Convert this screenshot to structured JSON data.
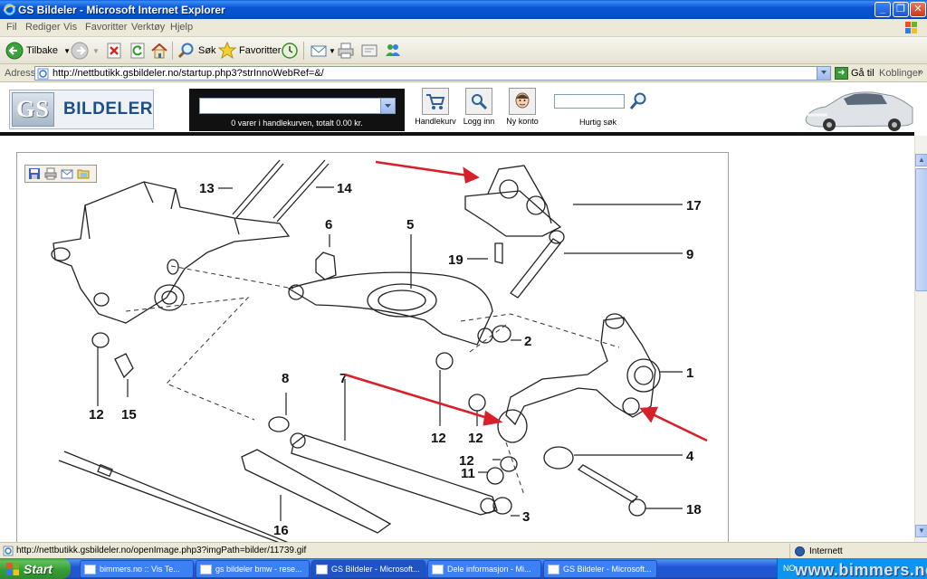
{
  "window": {
    "title": "GS Bildeler - Microsoft Internet Explorer",
    "minimize_glyph": "_",
    "maximize_glyph": "❐",
    "close_glyph": "✕"
  },
  "menu": [
    "Fil",
    "Rediger",
    "Vis",
    "Favoritter",
    "Verktøy",
    "Hjelp"
  ],
  "toolbar": {
    "back_label": "Tilbake",
    "search_label": "Søk",
    "favorites_label": "Favoritter"
  },
  "address": {
    "label": "Adresse",
    "url": "http://nettbutikk.gsbildeler.no/startup.php3?strInnoWebRef=&/",
    "go_label": "Gå til",
    "links_label": "Koblinger",
    "chevron": "»"
  },
  "site": {
    "logo_gs": "GS",
    "logo_name": "BILDELER",
    "basket_select_value": "",
    "basket_summary": "0 varer i handlekurven, totalt 0.00 kr.",
    "cart_label": "Handlekurv",
    "login_label": "Logg inn",
    "new_account_label": "Ny konto",
    "quick_search_label": "Hurtig søk",
    "quick_search_value": ""
  },
  "diagram": {
    "part_numbers": [
      "13",
      "14",
      "6",
      "5",
      "17",
      "19",
      "9",
      "2",
      "1",
      "12",
      "15",
      "8",
      "7",
      "12",
      "12",
      "4",
      "12",
      "11",
      "3",
      "16",
      "18"
    ]
  },
  "statusbar": {
    "text": "http://nettbutikk.gsbildeler.no/openImage.php3?imgPath=bilder/11739.gif",
    "zone": "Internett"
  },
  "taskbar": {
    "start_label": "Start",
    "tasks": [
      "bimmers.no :: Vis Te...",
      "gs bildeler bmw - rese...",
      "GS Bildeler - Microsoft...",
      "Dele informasjon - Mi...",
      "GS Bildeler - Microsoft..."
    ],
    "tray_text": "NO",
    "watermark": "www.bimmers.no"
  },
  "colors": {
    "xp_blue": "#0954d4",
    "arrow_red": "#d8202a",
    "start_green": "#379e35"
  }
}
